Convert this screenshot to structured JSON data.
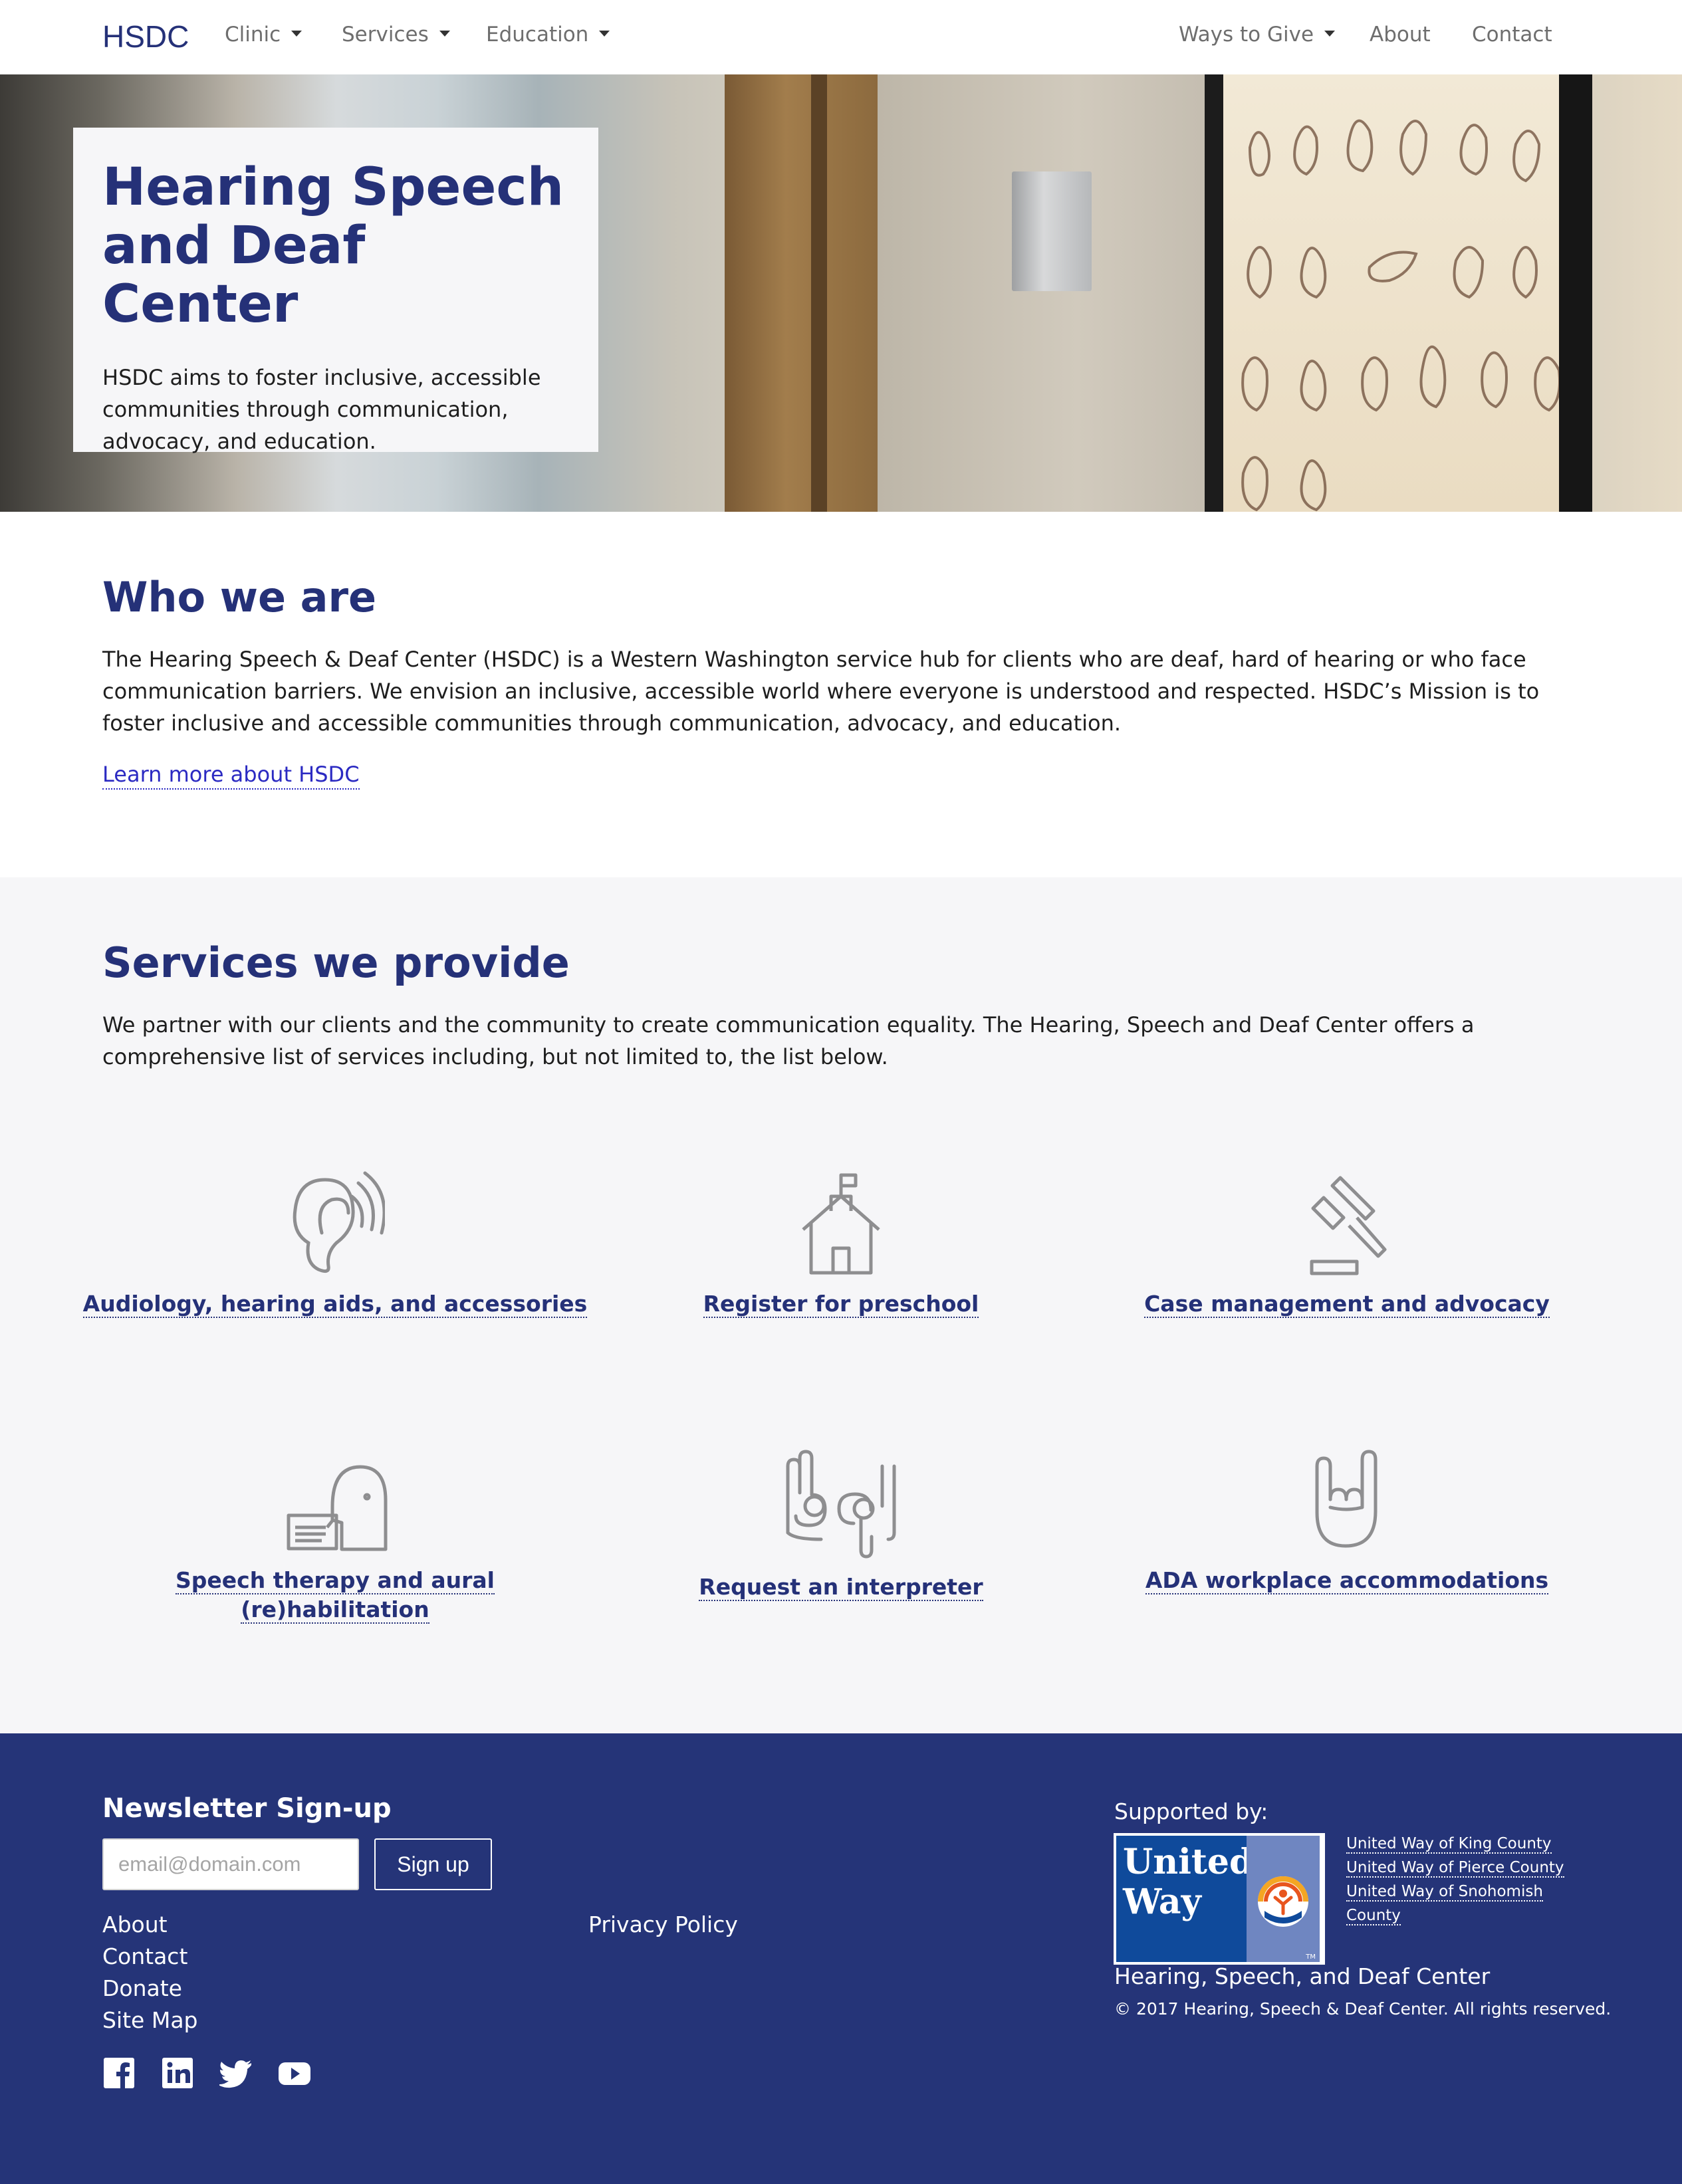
{
  "nav": {
    "brand": "HSDC",
    "items": [
      {
        "label": "Clinic",
        "dropdown": true
      },
      {
        "label": "Services",
        "dropdown": true
      },
      {
        "label": "Education",
        "dropdown": true
      },
      {
        "label": "Ways to Give",
        "dropdown": true
      },
      {
        "label": "About",
        "dropdown": false
      },
      {
        "label": "Contact",
        "dropdown": false
      }
    ]
  },
  "hero": {
    "title": "Hearing Speech and Deaf Center",
    "text": "HSDC aims to foster inclusive, accessible communities through communication, advocacy, and education."
  },
  "who": {
    "heading": "Who we are",
    "paragraph": "The Hearing Speech & Deaf Center (HSDC) is a Western Washington service hub for clients who are deaf, hard of hearing or who face communication barriers. We envision an inclusive, accessible world where everyone is understood and respected. HSDC’s Mission is to foster inclusive and accessible communities through communication, advocacy, and education.",
    "link": "Learn more about HSDC"
  },
  "services": {
    "heading": "Services we provide",
    "paragraph": "We partner with our clients and the community to create communication equality. The Hearing, Speech and Deaf Center offers a comprehensive list of services including, but not limited to, the list below.",
    "items": [
      {
        "label": "Audiology, hearing aids, and accessories",
        "icon": "ear-icon"
      },
      {
        "label": "Register for preschool",
        "icon": "schoolhouse-icon"
      },
      {
        "label": "Case management and advocacy",
        "icon": "gavel-icon"
      },
      {
        "label": "Speech therapy and aural (re)habilitation",
        "icon": "speech-head-icon"
      },
      {
        "label": "Request an interpreter",
        "icon": "sign-language-icon"
      },
      {
        "label": "ADA workplace accommodations",
        "icon": "ily-hand-icon"
      }
    ]
  },
  "footer": {
    "newsletter_title": "Newsletter Sign-up",
    "email_placeholder": "email@domain.com",
    "signup_label": "Sign up",
    "links_col1": [
      "About",
      "Contact",
      "Donate",
      "Site Map"
    ],
    "links_col2": [
      "Privacy Policy"
    ],
    "social": [
      "facebook-icon",
      "linkedin-icon",
      "twitter-icon",
      "youtube-icon"
    ],
    "supported_by": "Supported by:",
    "logo_text": "United Way",
    "united_way_links": [
      "United Way of King County",
      "United Way of Pierce County",
      "United Way of Snohomish County"
    ],
    "org_name": "Hearing, Speech, and Deaf Center",
    "copyright": "© 2017 Hearing, Speech & Deaf Center. All rights reserved."
  },
  "colors": {
    "brand_navy": "#253178",
    "footer_bg": "#253478",
    "link_blue": "#2b2ac2",
    "section_grey": "#f6f6f8"
  }
}
